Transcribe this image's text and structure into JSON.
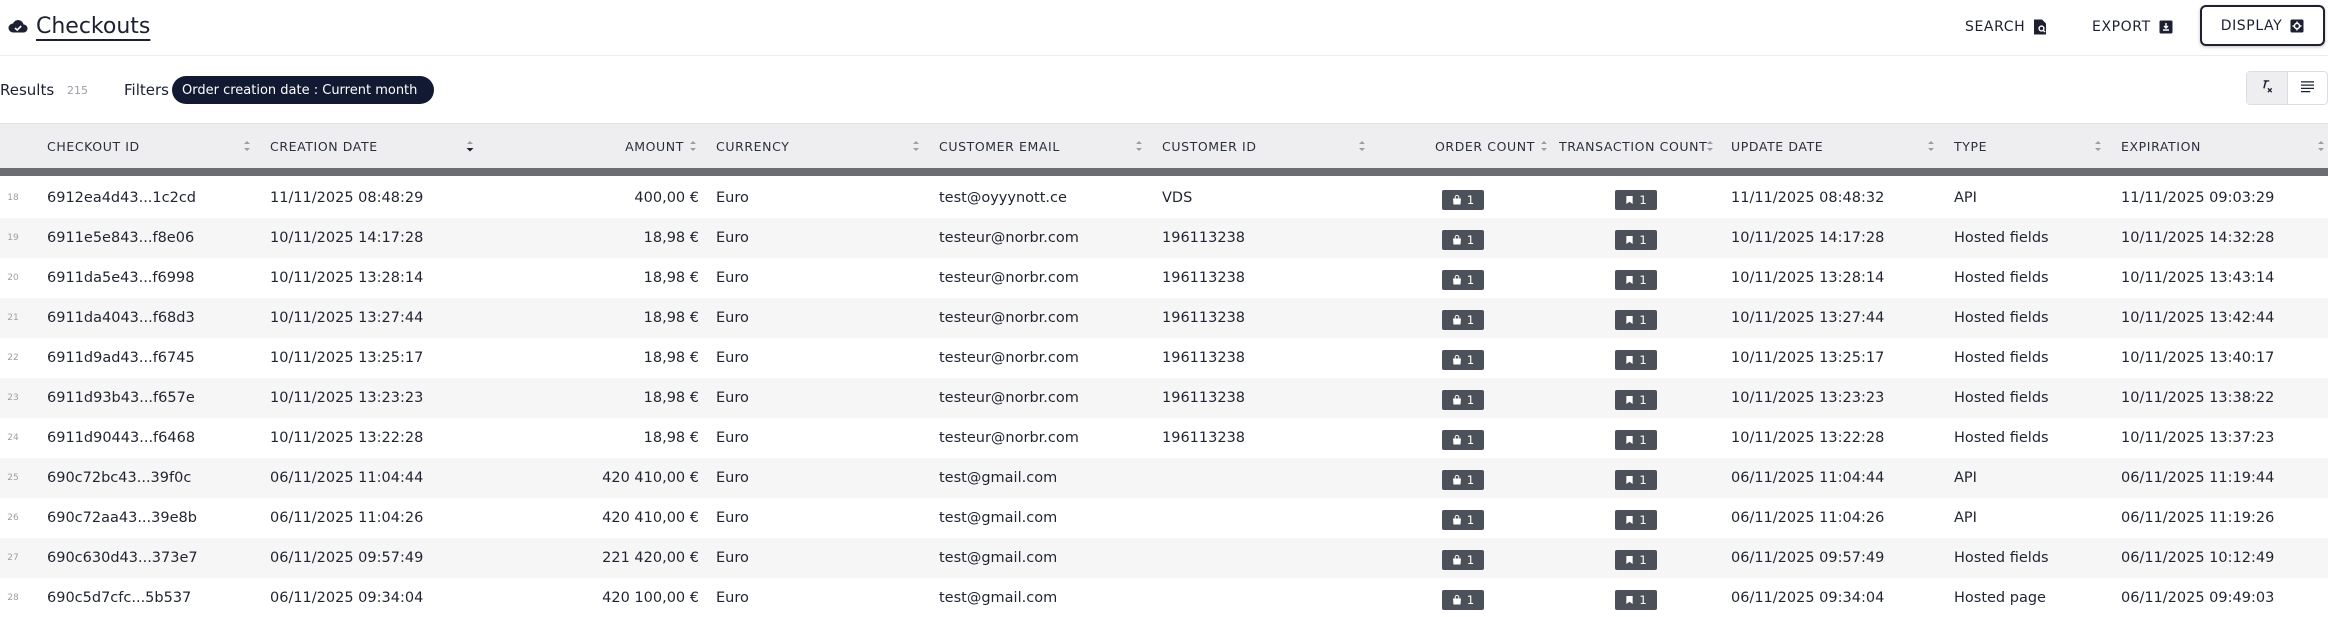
{
  "header": {
    "title": "Checkouts",
    "brand_icon": "cloud-check-icon",
    "actions": [
      {
        "label": "SEARCH",
        "icon": "search-document-icon"
      },
      {
        "label": "EXPORT",
        "icon": "export-icon"
      },
      {
        "label": "DISPLAY",
        "icon": "display-settings-icon"
      }
    ]
  },
  "filterbar": {
    "results_label": "Results",
    "results_count": "215",
    "filters_label": "Filters",
    "active_filter": "Order creation date : Current month",
    "view_toggles": [
      {
        "icon": "clear-format-icon",
        "active": true
      },
      {
        "icon": "list-view-icon",
        "active": false
      }
    ]
  },
  "table": {
    "columns": [
      {
        "key": "checkout_id",
        "label": "CHECKOUT ID"
      },
      {
        "key": "creation_date",
        "label": "CREATION DATE",
        "sorted": "desc"
      },
      {
        "key": "amount",
        "label": "AMOUNT"
      },
      {
        "key": "currency",
        "label": "CURRENCY"
      },
      {
        "key": "customer_email",
        "label": "CUSTOMER EMAIL"
      },
      {
        "key": "customer_id",
        "label": "CUSTOMER ID"
      },
      {
        "key": "order_count",
        "label": "ORDER COUNT"
      },
      {
        "key": "transaction_count",
        "label": "TRANSACTION COUNT"
      },
      {
        "key": "update_date",
        "label": "UPDATE DATE"
      },
      {
        "key": "type",
        "label": "TYPE"
      },
      {
        "key": "expiration",
        "label": "EXPIRATION"
      }
    ],
    "rows": [
      {
        "n": "18",
        "checkout_id": "6912ea4d43...1c2cd",
        "creation_date": "11/11/2025 08:48:29",
        "amount": "400,00 €",
        "currency": "Euro",
        "customer_email": "test@oyyynott.ce",
        "customer_id": "VDS",
        "order_count": "1",
        "transaction_count": "1",
        "update_date": "11/11/2025 08:48:32",
        "type": "API",
        "expiration": "11/11/2025 09:03:29"
      },
      {
        "n": "19",
        "checkout_id": "6911e5e843...f8e06",
        "creation_date": "10/11/2025 14:17:28",
        "amount": "18,98 €",
        "currency": "Euro",
        "customer_email": "testeur@norbr.com",
        "customer_id": "196113238",
        "order_count": "1",
        "transaction_count": "1",
        "update_date": "10/11/2025 14:17:28",
        "type": "Hosted fields",
        "expiration": "10/11/2025 14:32:28"
      },
      {
        "n": "20",
        "checkout_id": "6911da5e43...f6998",
        "creation_date": "10/11/2025 13:28:14",
        "amount": "18,98 €",
        "currency": "Euro",
        "customer_email": "testeur@norbr.com",
        "customer_id": "196113238",
        "order_count": "1",
        "transaction_count": "1",
        "update_date": "10/11/2025 13:28:14",
        "type": "Hosted fields",
        "expiration": "10/11/2025 13:43:14"
      },
      {
        "n": "21",
        "checkout_id": "6911da4043...f68d3",
        "creation_date": "10/11/2025 13:27:44",
        "amount": "18,98 €",
        "currency": "Euro",
        "customer_email": "testeur@norbr.com",
        "customer_id": "196113238",
        "order_count": "1",
        "transaction_count": "1",
        "update_date": "10/11/2025 13:27:44",
        "type": "Hosted fields",
        "expiration": "10/11/2025 13:42:44"
      },
      {
        "n": "22",
        "checkout_id": "6911d9ad43...f6745",
        "creation_date": "10/11/2025 13:25:17",
        "amount": "18,98 €",
        "currency": "Euro",
        "customer_email": "testeur@norbr.com",
        "customer_id": "196113238",
        "order_count": "1",
        "transaction_count": "1",
        "update_date": "10/11/2025 13:25:17",
        "type": "Hosted fields",
        "expiration": "10/11/2025 13:40:17"
      },
      {
        "n": "23",
        "checkout_id": "6911d93b43...f657e",
        "creation_date": "10/11/2025 13:23:23",
        "amount": "18,98 €",
        "currency": "Euro",
        "customer_email": "testeur@norbr.com",
        "customer_id": "196113238",
        "order_count": "1",
        "transaction_count": "1",
        "update_date": "10/11/2025 13:23:23",
        "type": "Hosted fields",
        "expiration": "10/11/2025 13:38:22"
      },
      {
        "n": "24",
        "checkout_id": "6911d90443...f6468",
        "creation_date": "10/11/2025 13:22:28",
        "amount": "18,98 €",
        "currency": "Euro",
        "customer_email": "testeur@norbr.com",
        "customer_id": "196113238",
        "order_count": "1",
        "transaction_count": "1",
        "update_date": "10/11/2025 13:22:28",
        "type": "Hosted fields",
        "expiration": "10/11/2025 13:37:23"
      },
      {
        "n": "25",
        "checkout_id": "690c72bc43...39f0c",
        "creation_date": "06/11/2025 11:04:44",
        "amount": "420 410,00 €",
        "currency": "Euro",
        "customer_email": "test@gmail.com",
        "customer_id": "",
        "order_count": "1",
        "transaction_count": "1",
        "update_date": "06/11/2025 11:04:44",
        "type": "API",
        "expiration": "06/11/2025 11:19:44"
      },
      {
        "n": "26",
        "checkout_id": "690c72aa43...39e8b",
        "creation_date": "06/11/2025 11:04:26",
        "amount": "420 410,00 €",
        "currency": "Euro",
        "customer_email": "test@gmail.com",
        "customer_id": "",
        "order_count": "1",
        "transaction_count": "1",
        "update_date": "06/11/2025 11:04:26",
        "type": "API",
        "expiration": "06/11/2025 11:19:26"
      },
      {
        "n": "27",
        "checkout_id": "690c630d43...373e7",
        "creation_date": "06/11/2025 09:57:49",
        "amount": "221 420,00 €",
        "currency": "Euro",
        "customer_email": "test@gmail.com",
        "customer_id": "",
        "order_count": "1",
        "transaction_count": "1",
        "update_date": "06/11/2025 09:57:49",
        "type": "Hosted fields",
        "expiration": "06/11/2025 10:12:49"
      },
      {
        "n": "28",
        "checkout_id": "690c5d7cfc...5b537",
        "creation_date": "06/11/2025 09:34:04",
        "amount": "420 100,00 €",
        "currency": "Euro",
        "customer_email": "test@gmail.com",
        "customer_id": "",
        "order_count": "1",
        "transaction_count": "1",
        "update_date": "06/11/2025 09:34:04",
        "type": "Hosted page",
        "expiration": "06/11/2025 09:49:03"
      }
    ]
  }
}
